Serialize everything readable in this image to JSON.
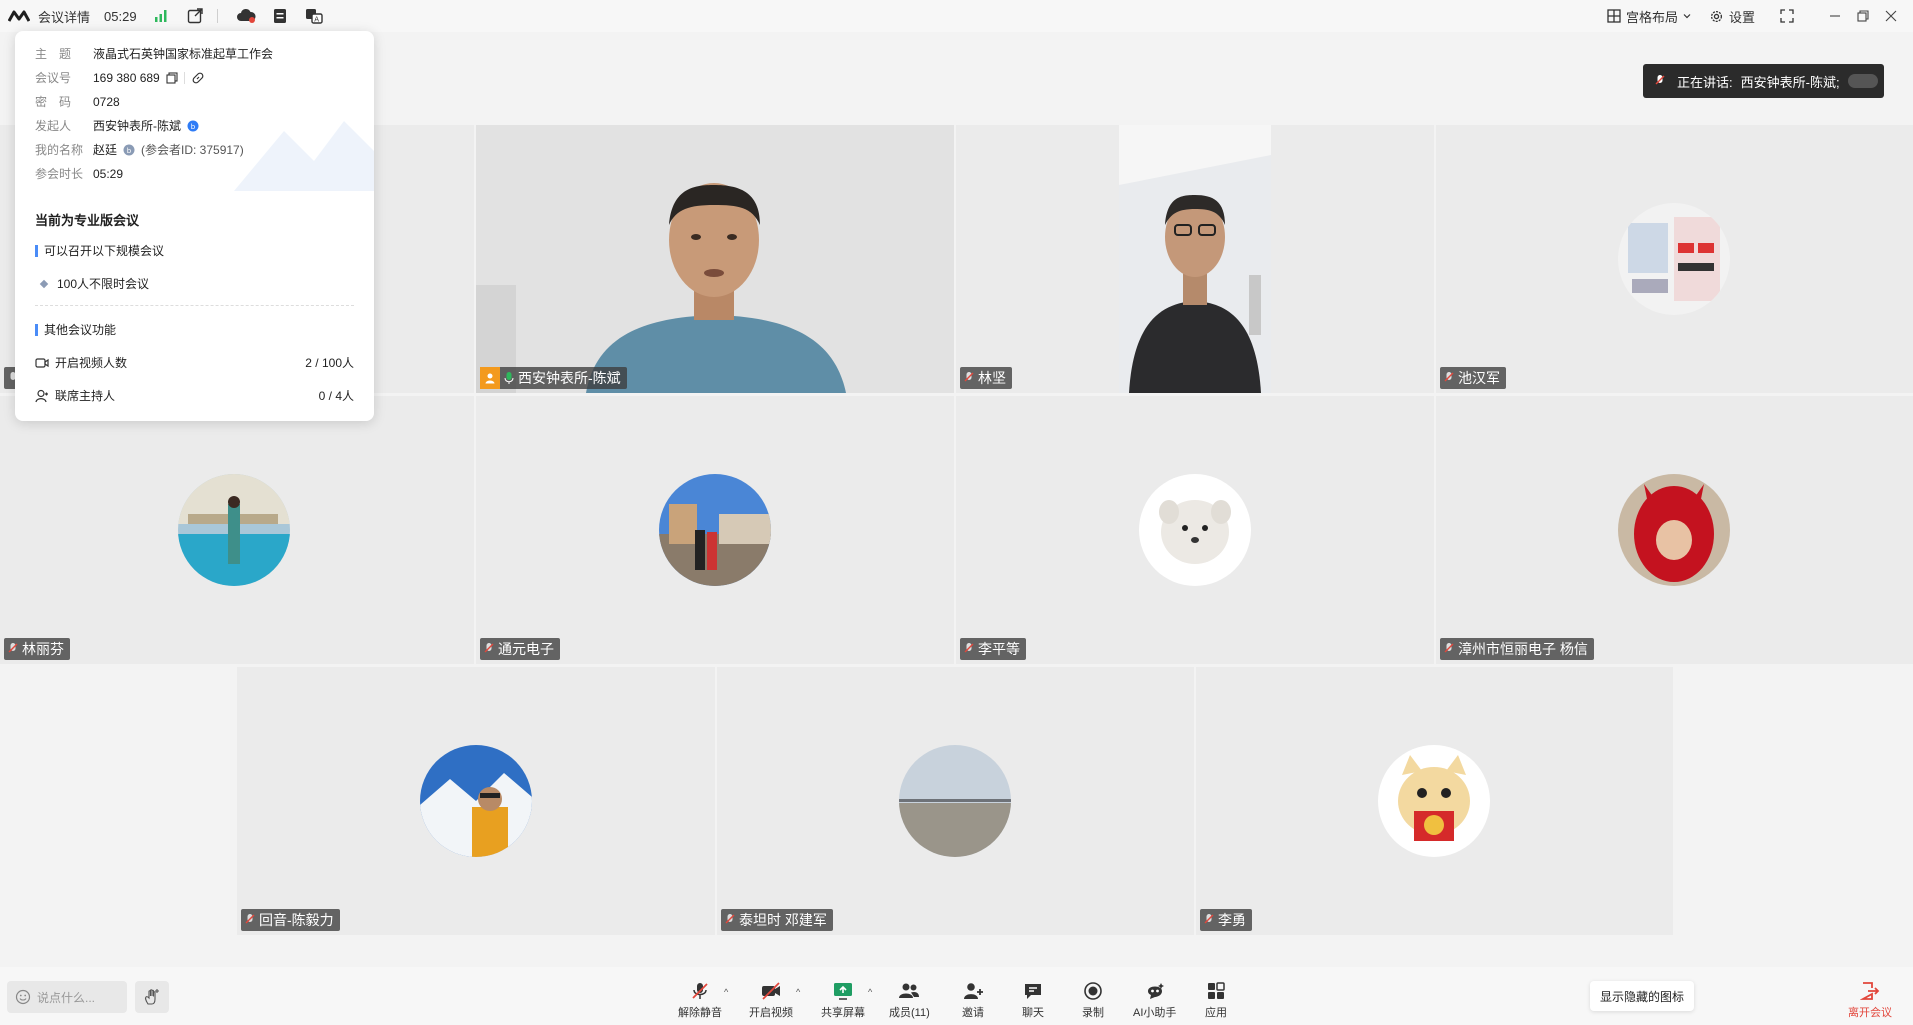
{
  "topbar": {
    "meeting_details": "会议详情",
    "elapsed": "05:29",
    "grid_layout": "宫格布局",
    "settings": "设置"
  },
  "speaking": {
    "label": "正在讲话:",
    "name": "西安钟表所-陈斌;"
  },
  "panel": {
    "rows": [
      {
        "label": "主　题",
        "value": "液晶式石英钟国家标准起草工作会"
      },
      {
        "label": "会议号",
        "value": "169 380 689"
      },
      {
        "label": "密　码",
        "value": "0728"
      },
      {
        "label": "发起人",
        "value": "西安钟表所-陈斌"
      },
      {
        "label": "我的名称",
        "value": "赵廷",
        "extra": "(参会者ID: 375917)"
      },
      {
        "label": "参会时长",
        "value": "05:29"
      }
    ],
    "edition_title": "当前为专业版会议",
    "scale_section": "可以召开以下规模会议",
    "scale_item": "100人不限时会议",
    "other_section": "其他会议功能",
    "video_count_label": "开启视频人数",
    "video_count_value": "2 / 100人",
    "cohost_label": "联席主持人",
    "cohost_value": "0 / 4人"
  },
  "participants": [
    {
      "name": "西安钟表所-陈斌"
    },
    {
      "name": "林坚"
    },
    {
      "name": "池汉军"
    },
    {
      "name": "林丽芬"
    },
    {
      "name": "通元电子"
    },
    {
      "name": "李平等"
    },
    {
      "name": "漳州市恒丽电子 杨信"
    },
    {
      "name": "回音-陈毅力"
    },
    {
      "name": "泰坦时 邓建军"
    },
    {
      "name": "李勇"
    }
  ],
  "bottombar": {
    "chat_placeholder": "说点什么...",
    "unmute": "解除静音",
    "start_video": "开启视频",
    "share_screen": "共享屏幕",
    "members": "成员(11)",
    "invite": "邀请",
    "chat": "聊天",
    "record": "录制",
    "ai_assistant": "AI小助手",
    "apps": "应用",
    "show_hidden_icons": "显示隐藏的图标",
    "leave": "离开会议"
  },
  "colors": {
    "active_border": "#1fc08b",
    "leave": "#e2463b",
    "host_badge": "#f39a1e",
    "accent": "#4a8cf7"
  }
}
